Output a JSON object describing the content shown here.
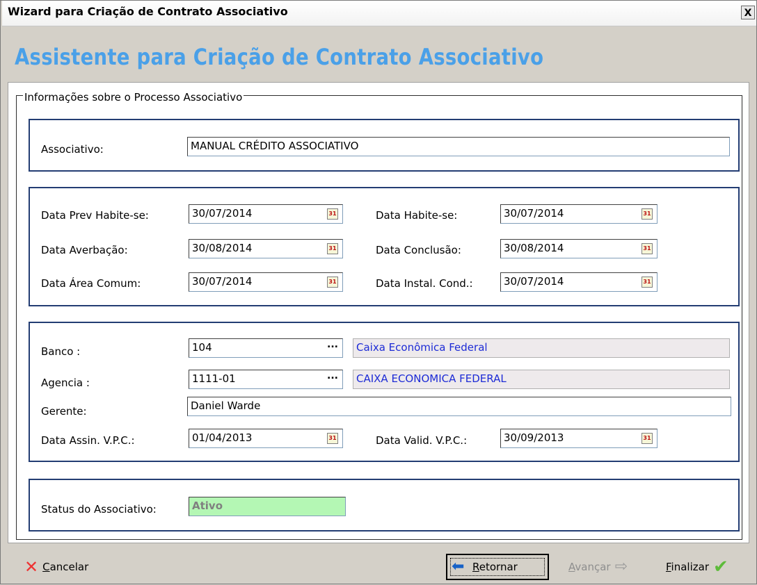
{
  "window": {
    "title": "Wizard para Criação de Contrato Associativo",
    "close_symbol": "X"
  },
  "heading": "Assistente para Criação de Contrato Associativo",
  "group_title": "Informações sobre o Processo Associativo",
  "associativo": {
    "label": "Associativo:",
    "value": "MANUAL CRÉDITO ASSOCIATIVO"
  },
  "dates": {
    "prev_habite_label": "Data Prev Habite-se:",
    "prev_habite_value": "30/07/2014",
    "habite_label": "Data Habite-se:",
    "habite_value": "30/07/2014",
    "averbacao_label": "Data Averbação:",
    "averbacao_value": "30/08/2014",
    "conclusao_label": "Data Conclusão:",
    "conclusao_value": "30/08/2014",
    "area_comum_label": "Data Área Comum:",
    "area_comum_value": "30/07/2014",
    "instal_label": "Data Instal. Cond.:",
    "instal_value": "30/07/2014"
  },
  "bank": {
    "banco_label": "Banco :",
    "banco_code": "104",
    "banco_name": "Caixa Econômica Federal",
    "agencia_label": "Agencia :",
    "agencia_code": "1111-01",
    "agencia_name": "CAIXA ECONOMICA FEDERAL",
    "gerente_label": "Gerente:",
    "gerente_value": "Daniel Warde",
    "assin_label": "Data Assin. V.P.C.:",
    "assin_value": "01/04/2013",
    "valid_label": "Data Valid. V.P.C.:",
    "valid_value": "30/09/2013",
    "lookup_symbol": "..."
  },
  "status": {
    "label": "Status do Associativo:",
    "value": "Ativo"
  },
  "calendar_glyph": "31",
  "footer": {
    "cancel_first": "C",
    "cancel_rest": "ancelar",
    "back_first": "R",
    "back_rest": "etornar",
    "next_first": "A",
    "next_rest": "vançar",
    "finish_first": "F",
    "finish_rest": "inalizar"
  },
  "icons": {
    "close": "close-icon",
    "calendar": "calendar-icon",
    "lookup": "ellipsis-icon",
    "cancel": "red-x-icon",
    "back": "blue-left-arrow-icon",
    "next": "gray-right-arrow-icon",
    "finish": "green-check-icon"
  },
  "colors": {
    "heading": "#4aa0e8",
    "panel_border": "#233d73",
    "status_bg": "#b4f7b4",
    "lookup_text": "#1d2bd6"
  }
}
